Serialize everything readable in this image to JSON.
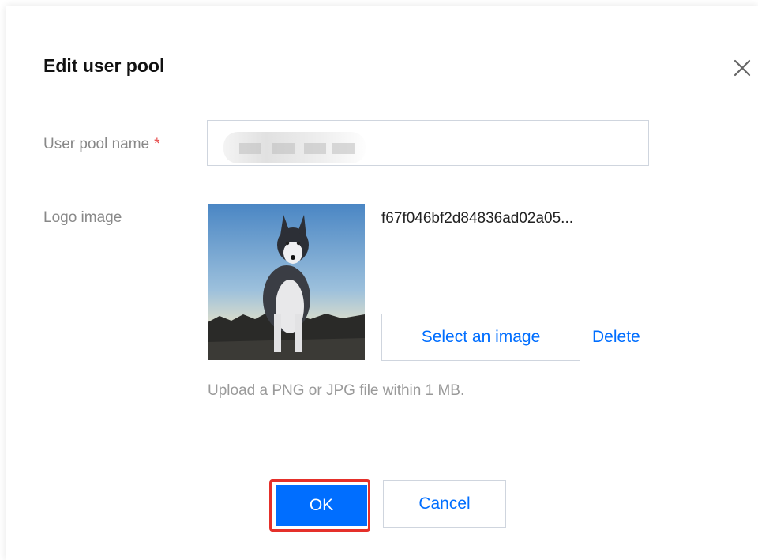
{
  "dialog": {
    "title": "Edit user pool",
    "close_icon": "close-icon"
  },
  "form": {
    "pool_name_label": "User pool name",
    "required_mark": "*",
    "pool_name_value": "",
    "logo_label": "Logo image",
    "logo_filename": "f67f046bf2d84836ad02a05...",
    "select_image_label": "Select an image",
    "delete_label": "Delete",
    "upload_hint": "Upload a PNG or JPG file within 1 MB."
  },
  "footer": {
    "ok_label": "OK",
    "cancel_label": "Cancel"
  },
  "colors": {
    "primary": "#006eff",
    "required": "#e54545",
    "highlight": "#e5302a"
  }
}
